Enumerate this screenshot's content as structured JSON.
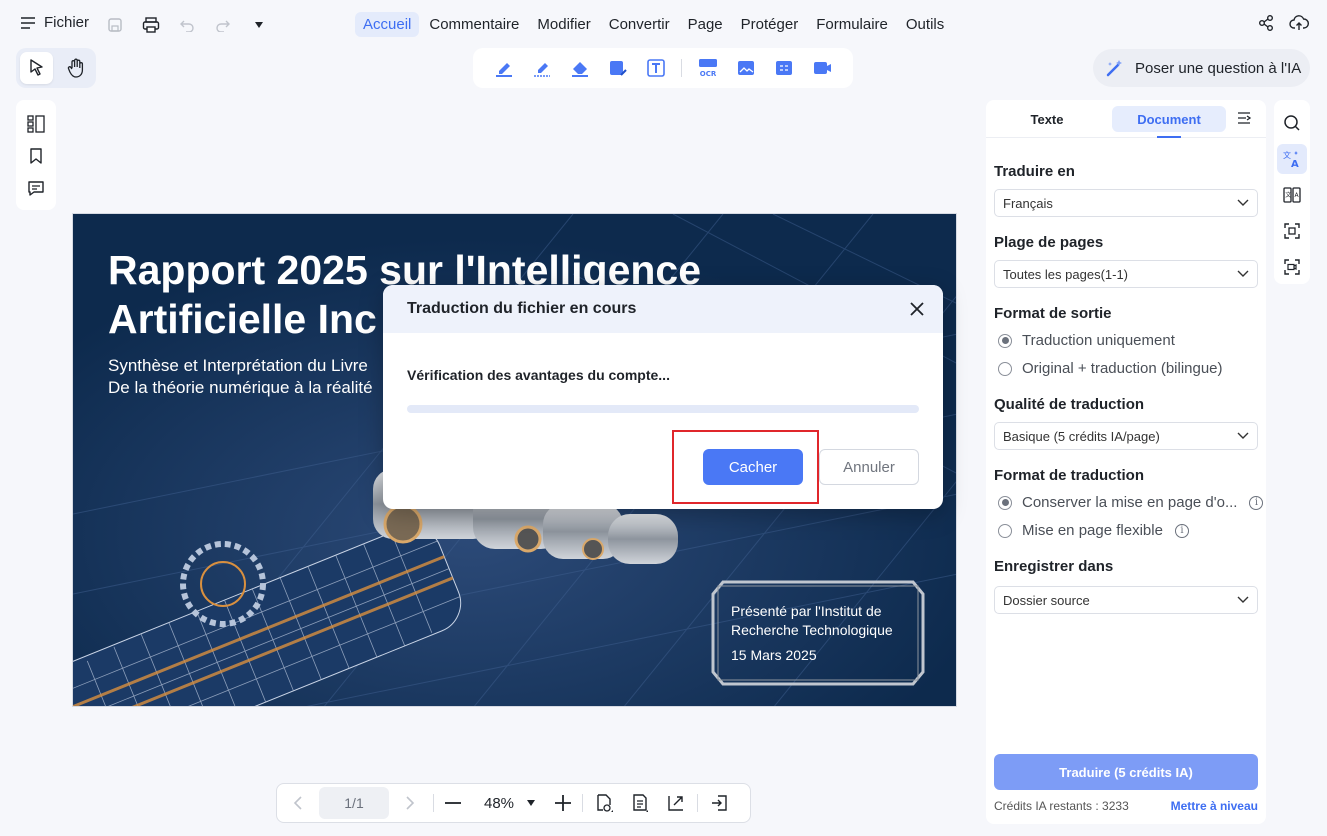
{
  "menubar": {
    "file_label": "Fichier",
    "tabs": [
      "Accueil",
      "Commentaire",
      "Modifier",
      "Convertir",
      "Page",
      "Protéger",
      "Formulaire",
      "Outils"
    ],
    "active_tab": "Accueil"
  },
  "ask_ai": {
    "label": "Poser une question à l'IA"
  },
  "document": {
    "title_line1": "Rapport 2025 sur l'Intelligence",
    "title_line2": "Artificielle Inc",
    "subtitle_line1": "Synthèse et Interprétation du Livre",
    "subtitle_line2": "De la théorie numérique à la réalité",
    "presented_line1": "Présenté par l'Institut de",
    "presented_line2": "Recherche Technologique",
    "date": "15 Mars 2025"
  },
  "modal": {
    "title": "Traduction du fichier en cours",
    "message": "Vérification des avantages du compte...",
    "progress": 0,
    "hide_label": "Cacher",
    "cancel_label": "Annuler"
  },
  "right_panel": {
    "tab_text": "Texte",
    "tab_document": "Document",
    "translate_to_label": "Traduire en",
    "translate_to_value": "Français",
    "page_range_label": "Plage de pages",
    "page_range_value": "Toutes les pages(1-1)",
    "output_format_label": "Format de sortie",
    "output_options": [
      "Traduction uniquement",
      "Original + traduction (bilingue)"
    ],
    "quality_label": "Qualité de traduction",
    "quality_value": "Basique (5 crédits IA/page)",
    "translation_format_label": "Format de traduction",
    "format_options": [
      "Conserver la mise en page d'o...",
      "Mise en page flexible"
    ],
    "save_in_label": "Enregistrer dans",
    "save_in_value": "Dossier source",
    "translate_button": "Traduire (5 crédits IA)",
    "credits_remaining": "Crédits IA restants : 3233",
    "upgrade_label": "Mettre à niveau"
  },
  "bottombar": {
    "page_indicator": "1/1",
    "zoom": "48%"
  },
  "colors": {
    "accent": "#3e6ef2",
    "page_bg": "#0d2a4d",
    "highlight": "#e0262b"
  }
}
